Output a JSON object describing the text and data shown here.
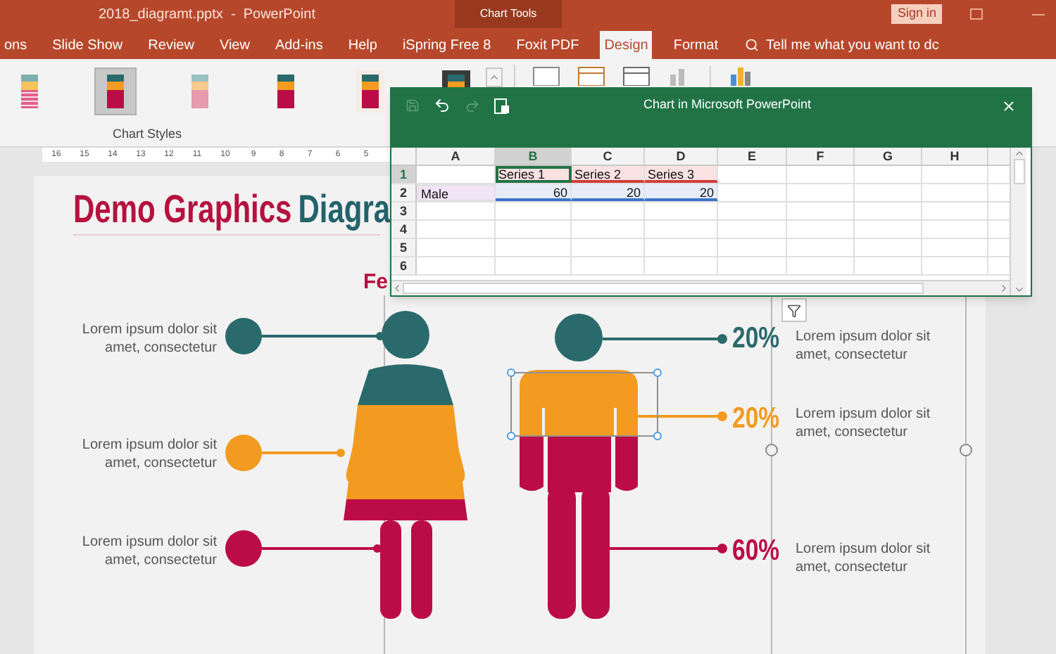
{
  "title_bar": {
    "document_title": "2018_diagramt.pptx  -  PowerPoint",
    "context_tab": "Chart Tools",
    "sign_in": "Sign in"
  },
  "ribbon_tabs": [
    {
      "label": "ons",
      "selected": false
    },
    {
      "label": "Slide Show",
      "selected": false
    },
    {
      "label": "Review",
      "selected": false
    },
    {
      "label": "View",
      "selected": false
    },
    {
      "label": "Add-ins",
      "selected": false
    },
    {
      "label": "Help",
      "selected": false
    },
    {
      "label": "iSpring Free 8",
      "selected": false
    },
    {
      "label": "Foxit PDF",
      "selected": false
    },
    {
      "label": "Design",
      "selected": true
    },
    {
      "label": "Format",
      "selected": false
    }
  ],
  "search": {
    "placeholder": "Tell me what you want to dc"
  },
  "ribbon": {
    "group_label": "Chart Styles",
    "chart_styles": [
      {
        "kind": "striped",
        "selected": false
      },
      {
        "kind": "plain",
        "selected": true
      },
      {
        "kind": "pale",
        "selected": false
      },
      {
        "kind": "plain",
        "selected": false
      },
      {
        "kind": "hatched",
        "selected": false
      },
      {
        "kind": "dark",
        "selected": false
      }
    ]
  },
  "ruler": [
    "16",
    "15",
    "14",
    "13",
    "12",
    "11",
    "10",
    "9",
    "8",
    "7",
    "6",
    "5"
  ],
  "spreadsheet": {
    "title": "Chart in Microsoft PowerPoint",
    "columns": [
      {
        "label": "A",
        "selected": false
      },
      {
        "label": "B",
        "selected": true
      },
      {
        "label": "C",
        "selected": false
      },
      {
        "label": "D",
        "selected": false
      },
      {
        "label": "E",
        "selected": false
      },
      {
        "label": "F",
        "selected": false
      },
      {
        "label": "G",
        "selected": false
      },
      {
        "label": "H",
        "selected": false
      }
    ],
    "rows": [
      {
        "label": "1",
        "selected": true,
        "cells": [
          {
            "kind": "empty",
            "selected": false
          },
          {
            "kind": "series",
            "text": "Series 1",
            "selected": true
          },
          {
            "kind": "series",
            "text": "Series 2",
            "selected": false
          },
          {
            "kind": "series",
            "text": "Series 3",
            "selected": false
          }
        ]
      },
      {
        "label": "2",
        "selected": false,
        "cells": [
          {
            "kind": "category",
            "text": "Male",
            "selected": false
          },
          {
            "kind": "value",
            "text": "60",
            "selected": false
          },
          {
            "kind": "value",
            "text": "20",
            "selected": false
          },
          {
            "kind": "value",
            "text": "20",
            "selected": false
          }
        ]
      },
      {
        "label": "3",
        "selected": false
      },
      {
        "label": "4",
        "selected": false
      },
      {
        "label": "5",
        "selected": false
      },
      {
        "label": "6",
        "selected": false
      }
    ]
  },
  "slide": {
    "title_parts": [
      {
        "text": "Demo Graphics",
        "color": "#b5123f"
      },
      {
        "text": "Diagra",
        "color": "#23636a"
      }
    ],
    "subtitle": "Fe",
    "left_items": [
      {
        "text": "Lorem ipsum dolor sit\namet, consectetur",
        "color": "#2a6a6c"
      },
      {
        "text": "Lorem ipsum dolor sit\namet, consectetur",
        "color": "#f29b20"
      },
      {
        "text": "Lorem ipsum dolor sit\namet, consectetur",
        "color": "#bb0c48"
      }
    ],
    "right_items": [
      {
        "value": "20%",
        "text": "Lorem ipsum dolor sit\namet, consectetur",
        "color": "#2a6a6c"
      },
      {
        "value": "20%",
        "text": "Lorem ipsum dolor sit\namet, consectetur",
        "color": "#f29b20"
      },
      {
        "value": "60%",
        "text": "Lorem ipsum dolor sit\namet, consectetur",
        "color": "#bb0c48"
      }
    ]
  }
}
